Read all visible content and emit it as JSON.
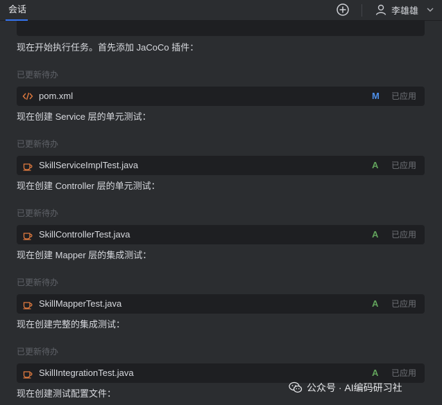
{
  "topbar": {
    "tab_label": "会话",
    "user_name": "李雄雄"
  },
  "messages": [
    "现在开始执行任务。首先添加 JaCoCo 插件：",
    "现在创建 Service 层的单元测试：",
    "现在创建 Controller 层的单元测试：",
    "现在创建 Mapper 层的集成测试：",
    "现在创建完整的集成测试：",
    "现在创建测试配置文件："
  ],
  "status_label": "已更新待办",
  "applied_label": "已应用",
  "files": [
    {
      "name": "pom.xml",
      "badge": "M",
      "badge_color": "#4e8fe8",
      "icon": "code-file-icon"
    },
    {
      "name": "SkillServiceImplTest.java",
      "badge": "A",
      "badge_color": "#62a35c",
      "icon": "java-file-icon"
    },
    {
      "name": "SkillControllerTest.java",
      "badge": "A",
      "badge_color": "#62a35c",
      "icon": "java-file-icon"
    },
    {
      "name": "SkillMapperTest.java",
      "badge": "A",
      "badge_color": "#62a35c",
      "icon": "java-file-icon"
    },
    {
      "name": "SkillIntegrationTest.java",
      "badge": "A",
      "badge_color": "#62a35c",
      "icon": "java-file-icon"
    }
  ],
  "watermark": {
    "text": "公众号 · AI编码研习社"
  },
  "colors": {
    "background": "#2b2d30",
    "card": "#1e1f22",
    "accent": "#3574f0",
    "file_icon": "#e07a3f"
  }
}
